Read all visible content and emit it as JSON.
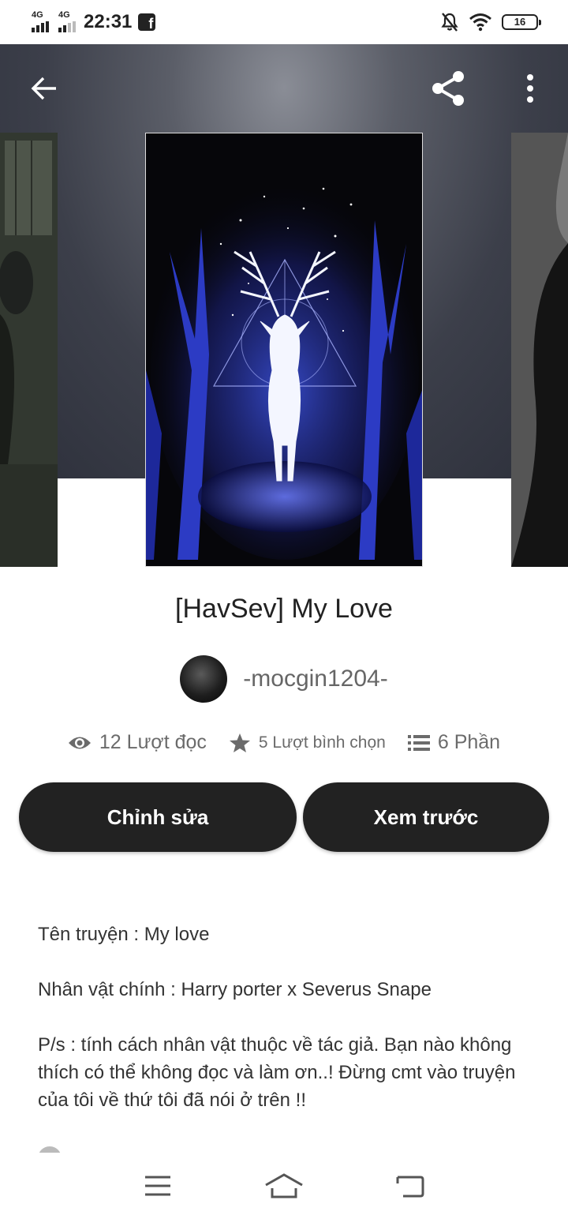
{
  "status_bar": {
    "network_1": "4G",
    "network_2": "4G",
    "time": "22:31",
    "battery": "16",
    "icons": [
      "signal-icon",
      "facebook-icon",
      "mute-bell-icon",
      "wifi-icon",
      "battery-icon"
    ]
  },
  "toolbar": {
    "back_icon": "arrow-left-icon",
    "share_icon": "share-icon",
    "menu_icon": "more-vertical-icon"
  },
  "story": {
    "title": "[HavSev] My Love",
    "author": "-mocgin1204-",
    "stats": {
      "reads": "12 Lượt đọc",
      "votes": "5 Lượt bình chọn",
      "parts": "6 Phần"
    }
  },
  "actions": {
    "edit_label": "Chỉnh sửa",
    "preview_label": "Xem trước"
  },
  "description": {
    "line1": "Tên truyện : My love",
    "line2": "Nhân vật chính : Harry porter x Severus Snape",
    "line3": "P/s : tính cách nhân vật thuộc về tác giả. Bạn nào không thích có thể không đọc và làm ơn..! Đừng cmt vào truyện của tôi về thứ tôi đã nói ở trên !!"
  },
  "nav": {
    "icons": [
      "menu-icon",
      "home-icon",
      "back-icon"
    ]
  },
  "colors": {
    "button_bg": "#222222",
    "stat_text": "#6b6b6b",
    "hero_bg": "#3c3f4a"
  }
}
